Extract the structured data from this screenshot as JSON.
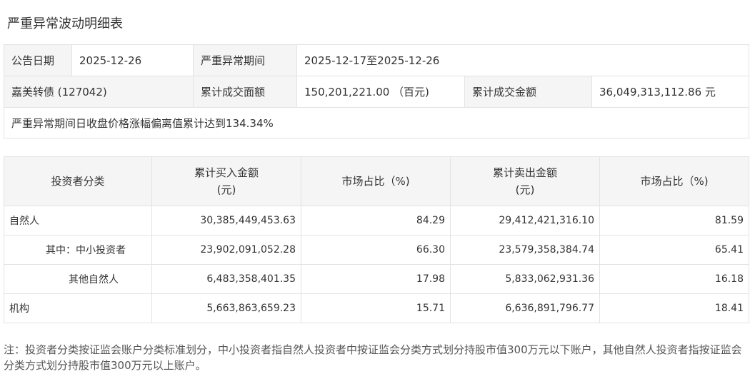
{
  "title": "严重异常波动明细表",
  "summary": {
    "announce_label": "公告日期",
    "announce_value": "2025-12-26",
    "period_label": "严重异常期间",
    "period_value": "2025-12-17至2025-12-26",
    "security": "嘉美转债 (127042)",
    "volume_label": "累计成交面额",
    "volume_value": "150,201,221.00 （百元)",
    "amount_label": "累计成交金额",
    "amount_value": "36,049,313,112.86 元",
    "deviation": "严重异常期间日收盘价格涨幅偏离值累计达到134.34%"
  },
  "table": {
    "headers": {
      "category": "投资者分类",
      "buy_amount_1": "累计买入金额",
      "buy_amount_2": "(元)",
      "buy_ratio": "市场占比（%)",
      "sell_amount_1": "累计卖出金额",
      "sell_amount_2": "(元)",
      "sell_ratio": "市场占比（%)"
    },
    "rows": [
      {
        "name": "自然人",
        "buy": "30,385,449,453.63",
        "buy_ratio": "84.29",
        "sell": "29,412,421,316.10",
        "sell_ratio": "81.59"
      },
      {
        "name": "其中：中小投资者",
        "buy": "23,902,091,052.28",
        "buy_ratio": "66.30",
        "sell": "23,579,358,384.74",
        "sell_ratio": "65.41"
      },
      {
        "name": "其他自然人",
        "buy": "6,483,358,401.35",
        "buy_ratio": "17.98",
        "sell": "5,833,062,931.36",
        "sell_ratio": "16.18"
      },
      {
        "name": "机构",
        "buy": "5,663,863,659.23",
        "buy_ratio": "15.71",
        "sell": "6,636,891,796.77",
        "sell_ratio": "18.41"
      }
    ]
  },
  "note": "注：投资者分类按证监会账户分类标准划分，中小投资者指自然人投资者中按证监会分类方式划分持股市值300万元以下账户，其他自然人投资者指按证监会分类方式划分持股市值300万元以上账户。"
}
